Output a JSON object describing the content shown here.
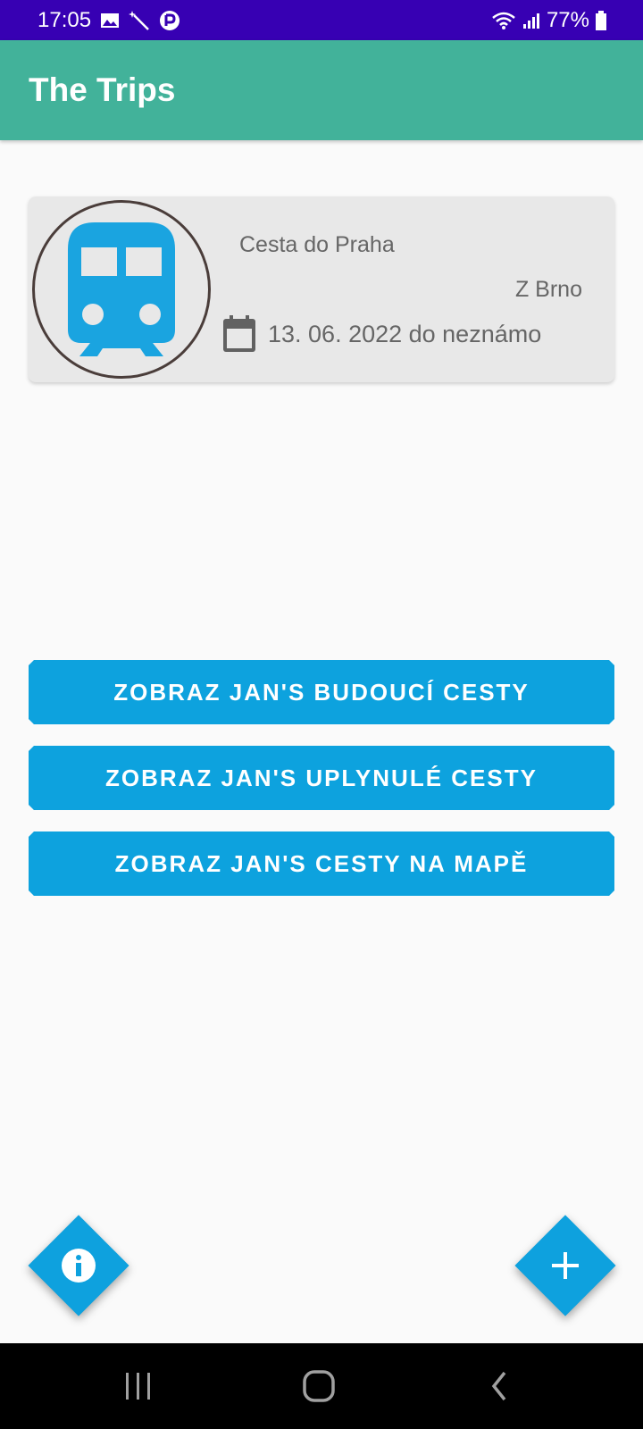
{
  "status_bar": {
    "time": "17:05",
    "icons_left": [
      "image-icon",
      "magic-wand-icon",
      "app-r-icon"
    ],
    "icons_right": [
      "wifi-icon",
      "signal-icon",
      "battery-icon"
    ],
    "battery": "77%"
  },
  "app_bar": {
    "title": "The Trips",
    "color": "#42b29a"
  },
  "trip_card": {
    "icon": "train-icon",
    "title": "Cesta do Praha",
    "from": "Z Brno",
    "date_icon": "calendar-icon",
    "date": "13. 06. 2022 do neznámo"
  },
  "buttons": {
    "future_trips": "ZOBRAZ JAN'S BUDOUCÍ CESTY",
    "past_trips": "ZOBRAZ JAN'S UPLYNULÉ CESTY",
    "trips_on_map": "ZOBRAZ JAN'S CESTY NA MAPĚ"
  },
  "fabs": {
    "info_icon": "info-icon",
    "add_icon": "plus-icon"
  },
  "nav_bar": {
    "recents_icon": "recents-icon",
    "home_icon": "home-icon",
    "back_icon": "back-icon"
  },
  "colors": {
    "status_bar": "#3700b3",
    "accent": "#0da2de",
    "train": "#1aa4e0"
  }
}
